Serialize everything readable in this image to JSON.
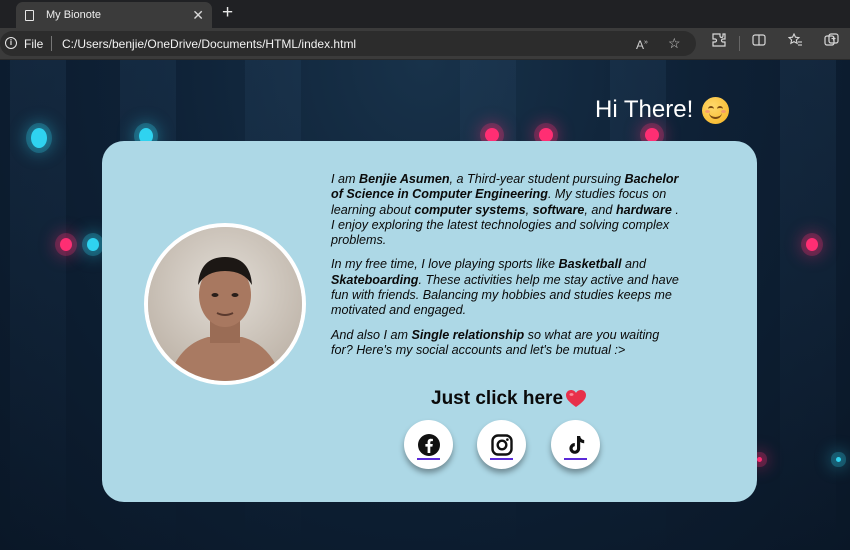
{
  "browser": {
    "tab_title": "My Bionote",
    "file_label": "File",
    "url": "C:/Users/benjie/OneDrive/Documents/HTML/index.html"
  },
  "page": {
    "greeting": "Hi There!",
    "bio": {
      "p1": [
        {
          "t": "I am "
        },
        {
          "t": "Benjie Asumen",
          "b": true
        },
        {
          "t": ", a Third-year student pursuing "
        },
        {
          "t": "Bachelor of Science in Computer Engineering",
          "b": true
        },
        {
          "t": ". My studies focus on learning about "
        },
        {
          "t": "computer systems",
          "b": true
        },
        {
          "t": ", "
        },
        {
          "t": "software",
          "b": true
        },
        {
          "t": ", and "
        },
        {
          "t": "hardware",
          "b": true
        },
        {
          "t": " . I enjoy exploring the latest technologies and solving complex problems."
        }
      ],
      "p2": [
        {
          "t": "In my free time, I love playing sports like "
        },
        {
          "t": "Basketball",
          "b": true
        },
        {
          "t": " and "
        },
        {
          "t": "Skateboarding",
          "b": true
        },
        {
          "t": ". These activities help me stay active and have fun with friends. Balancing my hobbies and studies keeps me motivated and engaged."
        }
      ],
      "p3": [
        {
          "t": "And also I am "
        },
        {
          "t": "Single relationship",
          "b": true
        },
        {
          "t": " so what are you waiting for? Here's my social accounts and let's be mutual :>"
        }
      ]
    },
    "cta": "Just click here",
    "social": [
      {
        "name": "facebook",
        "icon": "facebook-icon"
      },
      {
        "name": "instagram",
        "icon": "instagram-icon"
      },
      {
        "name": "tiktok",
        "icon": "tiktok-icon"
      }
    ]
  },
  "colors": {
    "card": "#add8e6",
    "background": "#0b1a2c",
    "glow_pink": "#ff2e73",
    "glow_cyan": "#2fd3f0",
    "social_underline": "#5b2ad8"
  }
}
